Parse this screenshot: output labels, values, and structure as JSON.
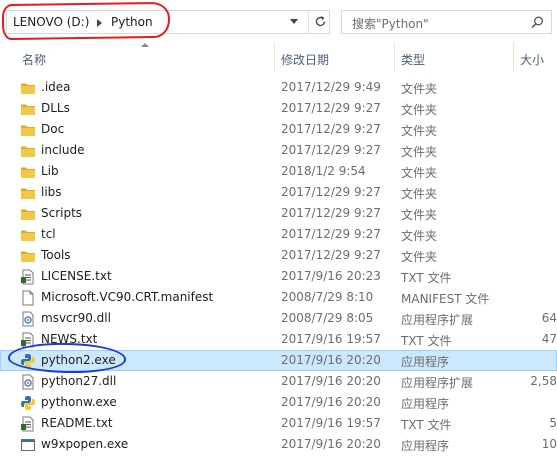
{
  "address": {
    "drive": "LENOVO (D:)",
    "folder": "Python"
  },
  "search": {
    "placeholder": "搜索\"Python\""
  },
  "columns": {
    "name": "名称",
    "date": "修改日期",
    "type": "类型",
    "size": "大小"
  },
  "files": [
    {
      "name": ".idea",
      "date": "2017/12/29 9:49",
      "type": "文件夹",
      "size": "",
      "icon": "folder-icon"
    },
    {
      "name": "DLLs",
      "date": "2017/12/29 9:27",
      "type": "文件夹",
      "size": "",
      "icon": "folder-icon"
    },
    {
      "name": "Doc",
      "date": "2017/12/29 9:27",
      "type": "文件夹",
      "size": "",
      "icon": "folder-icon"
    },
    {
      "name": "include",
      "date": "2017/12/29 9:27",
      "type": "文件夹",
      "size": "",
      "icon": "folder-icon"
    },
    {
      "name": "Lib",
      "date": "2018/1/2 9:54",
      "type": "文件夹",
      "size": "",
      "icon": "folder-icon"
    },
    {
      "name": "libs",
      "date": "2017/12/29 9:27",
      "type": "文件夹",
      "size": "",
      "icon": "folder-icon"
    },
    {
      "name": "Scripts",
      "date": "2017/12/29 9:27",
      "type": "文件夹",
      "size": "",
      "icon": "folder-icon"
    },
    {
      "name": "tcl",
      "date": "2017/12/29 9:27",
      "type": "文件夹",
      "size": "",
      "icon": "folder-icon"
    },
    {
      "name": "Tools",
      "date": "2017/12/29 9:27",
      "type": "文件夹",
      "size": "",
      "icon": "folder-icon"
    },
    {
      "name": "LICENSE.txt",
      "date": "2017/9/16 20:23",
      "type": "TXT 文件",
      "size": "",
      "icon": "text-file-icon"
    },
    {
      "name": "Microsoft.VC90.CRT.manifest",
      "date": "2008/7/29 8:10",
      "type": "MANIFEST 文件",
      "size": "",
      "icon": "file-icon"
    },
    {
      "name": "msvcr90.dll",
      "date": "2008/7/29 8:05",
      "type": "应用程序扩展",
      "size": "64",
      "icon": "dll-icon"
    },
    {
      "name": "NEWS.txt",
      "date": "2017/9/16 19:57",
      "type": "TXT 文件",
      "size": "47",
      "icon": "text-file-icon"
    },
    {
      "name": "python2.exe",
      "date": "2017/9/16 20:20",
      "type": "应用程序",
      "size": "",
      "icon": "python-icon"
    },
    {
      "name": "python27.dll",
      "date": "2017/9/16 20:20",
      "type": "应用程序扩展",
      "size": "2,58",
      "icon": "dll-icon"
    },
    {
      "name": "pythonw.exe",
      "date": "2017/9/16 20:20",
      "type": "应用程序",
      "size": "",
      "icon": "python-icon"
    },
    {
      "name": "README.txt",
      "date": "2017/9/16 19:57",
      "type": "TXT 文件",
      "size": "5",
      "icon": "text-file-icon"
    },
    {
      "name": "w9xpopen.exe",
      "date": "2017/9/16 20:20",
      "type": "应用程序",
      "size": "10",
      "icon": "exe-icon"
    }
  ],
  "selected_index": 13,
  "colors": {
    "selection_bg": "#cce8ff",
    "folder": "#e8b843",
    "red_annotation": "#e01f1f",
    "blue_annotation": "#1a3bd6"
  }
}
